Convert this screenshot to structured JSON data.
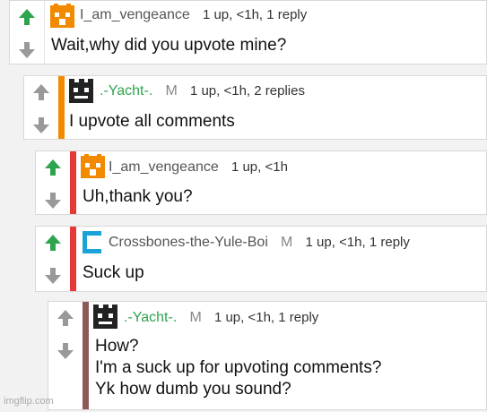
{
  "comments": [
    {
      "username": "I_am_vengeance",
      "stats": "1 up, <1h, 1 reply",
      "text": "Wait,why did you upvote mine?",
      "bar_color": "#ffffff",
      "avatar": "fox-icon",
      "upvoted": true
    },
    {
      "username": ".-Yacht-.",
      "mod_badge": "M",
      "stats": "1 up, <1h, 2 replies",
      "text": "I upvote all comments",
      "bar_color": "#f28a00",
      "avatar": "pixel-face-icon",
      "upvoted": false
    },
    {
      "username": "I_am_vengeance",
      "stats": "1 up, <1h",
      "text": "Uh,thank you?",
      "bar_color": "#e53935",
      "avatar": "fox-icon",
      "upvoted": true
    },
    {
      "username": "Crossbones-the-Yule-Boi",
      "mod_badge": "M",
      "stats": "1 up, <1h, 1 reply",
      "text": "Suck up",
      "bar_color": "#e53935",
      "avatar": "cyan-bracket-icon",
      "upvoted": true
    },
    {
      "username": ".-Yacht-.",
      "mod_badge": "M",
      "stats": "1 up, <1h, 1 reply",
      "text": "How?\nI'm a suck up for upvoting comments?\nYk how dumb you sound?",
      "bar_color": "#8d5a5a",
      "avatar": "pixel-face-icon",
      "upvoted": false
    }
  ],
  "watermark": "imgflip.com",
  "colors": {
    "upvote_active": "#2ea44f",
    "vote_inactive": "#999999",
    "fox": "#f28a00",
    "cyan": "#1aa3d6"
  }
}
